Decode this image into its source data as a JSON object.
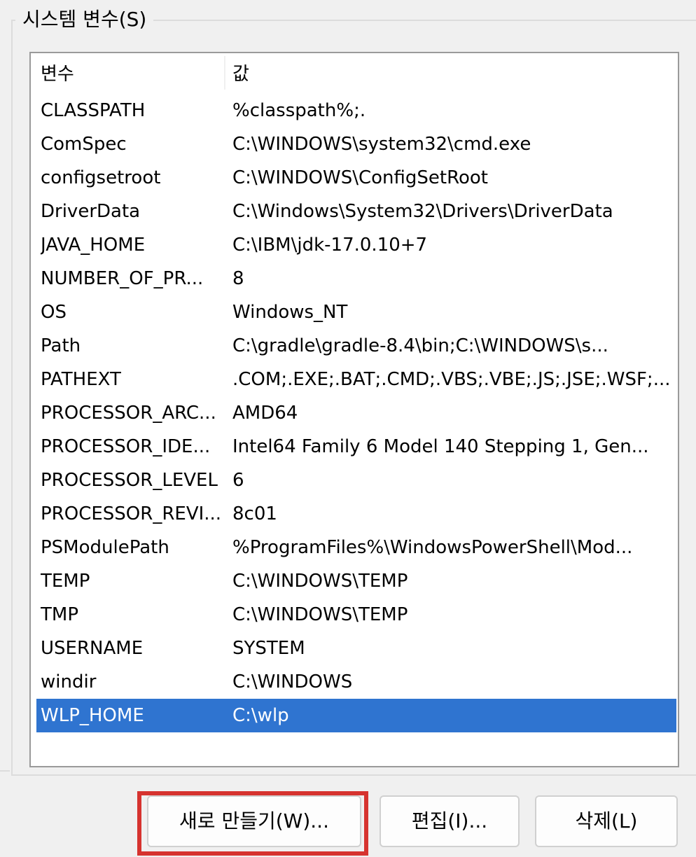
{
  "group": {
    "title": "시스템 변수(S)"
  },
  "list": {
    "columns": {
      "variable": "변수",
      "value": "값"
    },
    "rows": [
      {
        "name": "CLASSPATH",
        "value": "%classpath%;."
      },
      {
        "name": "ComSpec",
        "value": "C:\\WINDOWS\\system32\\cmd.exe"
      },
      {
        "name": "configsetroot",
        "value": "C:\\WINDOWS\\ConfigSetRoot"
      },
      {
        "name": "DriverData",
        "value": "C:\\Windows\\System32\\Drivers\\DriverData"
      },
      {
        "name": "JAVA_HOME",
        "value": "C:\\IBM\\jdk-17.0.10+7"
      },
      {
        "name": "NUMBER_OF_PR...",
        "value": "8"
      },
      {
        "name": "OS",
        "value": "Windows_NT"
      },
      {
        "name": "Path",
        "value": "C:\\gradle\\gradle-8.4\\bin;C:\\WINDOWS\\s..."
      },
      {
        "name": "PATHEXT",
        "value": ".COM;.EXE;.BAT;.CMD;.VBS;.VBE;.JS;.JSE;.WSF;...."
      },
      {
        "name": "PROCESSOR_ARC...",
        "value": "AMD64"
      },
      {
        "name": "PROCESSOR_IDE...",
        "value": "Intel64 Family 6 Model 140 Stepping 1, Gen..."
      },
      {
        "name": "PROCESSOR_LEVEL",
        "value": "6"
      },
      {
        "name": "PROCESSOR_REVI...",
        "value": "8c01"
      },
      {
        "name": "PSModulePath",
        "value": "%ProgramFiles%\\WindowsPowerShell\\Mod..."
      },
      {
        "name": "TEMP",
        "value": "C:\\WINDOWS\\TEMP"
      },
      {
        "name": "TMP",
        "value": "C:\\WINDOWS\\TEMP"
      },
      {
        "name": "USERNAME",
        "value": "SYSTEM"
      },
      {
        "name": "windir",
        "value": "C:\\WINDOWS"
      },
      {
        "name": "WLP_HOME",
        "value": "C:\\wlp",
        "selected": true
      }
    ]
  },
  "buttons": {
    "new_label": "새로 만들기(W)...",
    "edit_label": "편집(I)...",
    "delete_label": "삭제(L)"
  },
  "colors": {
    "selection": "#2f74d0",
    "highlight_box": "#d6332f"
  }
}
